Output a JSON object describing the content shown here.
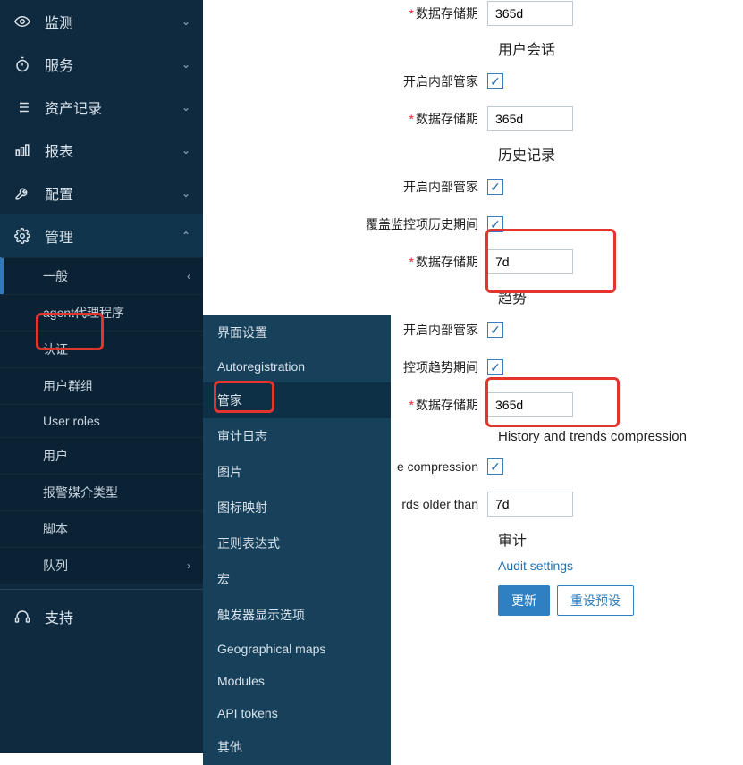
{
  "sidebar": {
    "items": [
      {
        "label": "监测",
        "icon": "eye"
      },
      {
        "label": "服务",
        "icon": "stopwatch"
      },
      {
        "label": "资产记录",
        "icon": "list"
      },
      {
        "label": "报表",
        "icon": "barchart"
      },
      {
        "label": "配置",
        "icon": "wrench"
      },
      {
        "label": "管理",
        "icon": "gear"
      }
    ],
    "admin_sub": [
      {
        "label": "一般"
      },
      {
        "label": "agent代理程序"
      },
      {
        "label": "认证"
      },
      {
        "label": "用户群组"
      },
      {
        "label": "User roles"
      },
      {
        "label": "用户"
      },
      {
        "label": "报警媒介类型"
      },
      {
        "label": "脚本"
      },
      {
        "label": "队列"
      }
    ],
    "support": "支持"
  },
  "flyout": {
    "items": [
      "界面设置",
      "Autoregistration",
      "管家",
      "审计日志",
      "图片",
      "图标映射",
      "正则表达式",
      "宏",
      "触发器显示选项",
      "Geographical maps",
      "Modules",
      "API tokens",
      "其他"
    ]
  },
  "form": {
    "data_storage_period": "数据存储期",
    "val_365d": "365d",
    "val_7d": "7d",
    "section_user_session": "用户会话",
    "enable_internal_hk": "开启内部管家",
    "section_history": "历史记录",
    "override_item_history": "覆盖监控项历史期间",
    "section_trends": "趋势",
    "override_item_trends_suffix": "控项趋势期间",
    "section_compression": "History and trends compression",
    "enable_compression_suffix": "e compression",
    "records_older_than_suffix": "rds older than",
    "section_audit": "审计",
    "audit_settings": "Audit settings",
    "btn_update": "更新",
    "btn_reset": "重设预设"
  }
}
